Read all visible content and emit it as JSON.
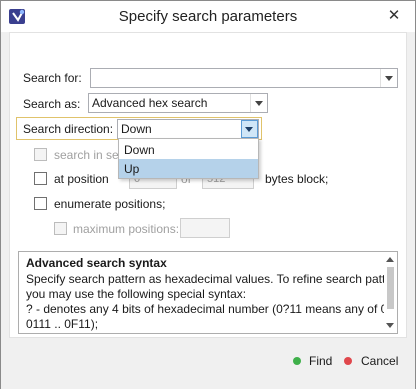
{
  "window": {
    "title": "Specify search parameters",
    "close_glyph": "✕"
  },
  "form": {
    "search_for": {
      "label": "Search for:",
      "value": ""
    },
    "search_as": {
      "label": "Search as:",
      "value": "Advanced hex search"
    },
    "search_direction": {
      "label": "Search direction:",
      "value": "Down",
      "options": [
        "Down",
        "Up"
      ],
      "highlighted": "Up"
    },
    "search_in_selection": {
      "label": "search in sele",
      "checked": false,
      "enabled": false
    },
    "at_position": {
      "label": "at position",
      "checked": false,
      "unit_label": "bytes block;",
      "covered_left": "0",
      "covered_mid": "of",
      "covered_right": "512"
    },
    "enumerate_positions": {
      "label": "enumerate positions;",
      "checked": false
    },
    "maximum_positions": {
      "label": "maximum positions:",
      "checked": false,
      "enabled": false,
      "value": ""
    }
  },
  "help": {
    "title": "Advanced search syntax",
    "lines": [
      "Specify search pattern as hexadecimal values. To refine search pattern",
      "you may use the following special syntax:",
      " ? - denotes any 4 bits of hexadecimal number (0?11 means any of 0011,",
      "0111 .. 0F11);"
    ]
  },
  "footer": {
    "find_label": "Find",
    "cancel_label": "Cancel"
  },
  "colors": {
    "find_dot": "#3fb04a",
    "cancel_dot": "#e0474c",
    "focus_frame": "#e0c36b",
    "dropdown_highlight": "#b5d2ea"
  },
  "icons": {
    "app": "search-app-icon",
    "close": "close-icon",
    "dropdown": "chevron-down-icon",
    "find": "green-dot-icon",
    "cancel": "red-dot-icon"
  }
}
